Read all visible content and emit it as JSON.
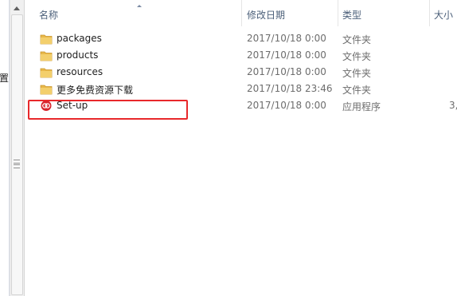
{
  "nav": {
    "partial_text": "置"
  },
  "header": {
    "name": "名称",
    "modified": "修改日期",
    "type": "类型",
    "size": "大小"
  },
  "rows": [
    {
      "name": "packages",
      "modified": "2017/10/18 0:00",
      "type": "文件夹",
      "size": "",
      "icon": "folder-icon"
    },
    {
      "name": "products",
      "modified": "2017/10/18 0:00",
      "type": "文件夹",
      "size": "",
      "icon": "folder-icon"
    },
    {
      "name": "resources",
      "modified": "2017/10/18 0:00",
      "type": "文件夹",
      "size": "",
      "icon": "folder-icon"
    },
    {
      "name": "更多免费资源下载",
      "modified": "2017/10/18 23:46",
      "type": "文件夹",
      "size": "",
      "icon": "folder-icon"
    },
    {
      "name": "Set-up",
      "modified": "2017/10/18 0:00",
      "type": "应用程序",
      "size": "3,",
      "icon": "adobe-cc-app-icon"
    }
  ],
  "colors": {
    "folder": "#e8b84a",
    "app_icon": "#d7242c",
    "highlight": "#e8282b",
    "header_text": "#4c607a"
  }
}
